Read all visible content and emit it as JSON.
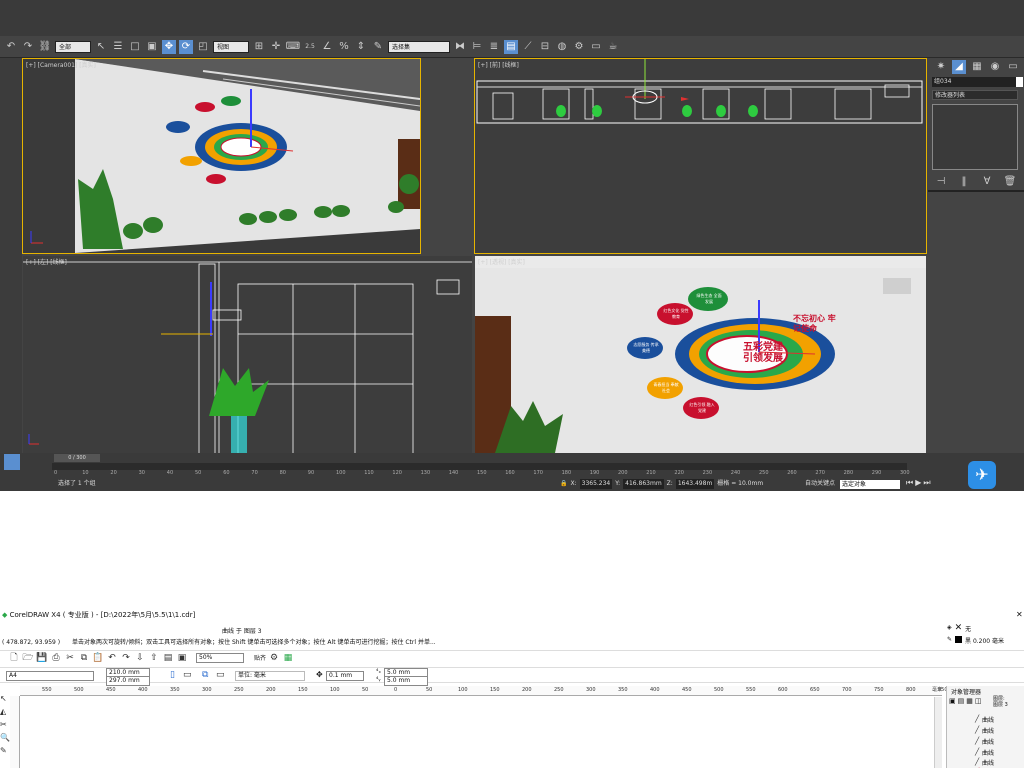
{
  "max": {
    "toolbar": {
      "filter_select": "全部",
      "view_select": "视图",
      "snap_text": "2.5",
      "sel_set_select": "选择集",
      "buttons": [
        "undo-icon",
        "redo-icon",
        "link-icon",
        "select-icon",
        "region-icon",
        "move-icon",
        "rotate-icon",
        "scale-icon",
        "snap-icon",
        "angle-snap-icon",
        "percent-snap-icon",
        "spinner-snap-icon",
        "mirror-icon",
        "align-icon",
        "layer-icon",
        "graph-icon",
        "material-icon",
        "render-setup-icon",
        "render-icon",
        "render-frame-icon"
      ]
    },
    "viewports": {
      "camera": "[+] [Camera001] [真实]",
      "front": "[+] [前] [线框]",
      "left": "[+] [左] [线框]",
      "perspective": "[+] [透视] [真实]"
    },
    "sign": {
      "center_line1": "五彩党建",
      "center_line2": "引领发展",
      "arc_text": "不忘初心 牢记使命",
      "bubble1": "绿色生态 全面发展",
      "bubble2": "红色文化 党性教育",
      "bubble3": "志愿服务 传承美德",
      "bubble4": "青春担当 奉献社会",
      "bubble5": "红色引领 融入党建",
      "bubble1_color": "#1e8f3a",
      "bubble2_color": "#c8102e",
      "bubble3_color": "#1a4f9c",
      "bubble4_color": "#f2a100",
      "bubble5_color": "#c8102e"
    },
    "command_panel": {
      "object_name": "组034",
      "modifier_list": "修改器列表"
    },
    "timeline": {
      "frame_counter": "0 / 300",
      "ruler": [
        "0",
        "10",
        "20",
        "30",
        "40",
        "50",
        "60",
        "70",
        "80",
        "90",
        "100",
        "110",
        "120",
        "130",
        "140",
        "150",
        "160",
        "170",
        "180",
        "190",
        "200",
        "210",
        "220",
        "230",
        "240",
        "250",
        "260",
        "270",
        "280",
        "290",
        "300"
      ]
    },
    "status": {
      "selection_text": "选择了 1 个组",
      "x_label": "X:",
      "x": "3365.234",
      "y_label": "Y:",
      "y": "416.863mm",
      "z_label": "Z:",
      "z": "1643.498m",
      "grid": "栅格 = 10.0mm",
      "auto_key": "自动关键点",
      "key_select": "选定对象"
    }
  },
  "corel": {
    "title": "CorelDRAW X4 ( 专业版 ) - [D:\\2022年\\5月\\5.5\\1\\1.cdr]",
    "status_center": "曲线 于 图层 3",
    "hint_coords": "( 478.872, 93.959 )",
    "hint_text": "单击对象两次可旋转/倾斜；双击工具可选择所有对象；按住 Shift 键单击可选择多个对象；按住 Alt 键单击可进行挖掘；按住 Ctrl 并单...",
    "fill": "无",
    "outline": "黑  0.200 毫米",
    "zoom": "50%",
    "snap_label": "贴齐",
    "paper": "A4",
    "width": "210.0 mm",
    "height": "297.0 mm",
    "unit_label": "单位: 毫米",
    "nudge": "0.1 mm",
    "dup_x": "5.0 mm",
    "dup_y": "5.0 mm",
    "ruler": [
      "550",
      "500",
      "450",
      "400",
      "350",
      "300",
      "250",
      "200",
      "150",
      "100",
      "50",
      "0",
      "50",
      "100",
      "150",
      "200",
      "250",
      "300",
      "350",
      "400",
      "450",
      "500",
      "550",
      "600",
      "650",
      "700",
      "750",
      "800",
      "850"
    ],
    "ruler_unit": "毫米",
    "object_manager": {
      "title": "对象管理器",
      "layer": "图层:",
      "layer_name": "图层 3",
      "items": [
        "曲线",
        "曲线",
        "曲线",
        "曲线",
        "曲线",
        "曲线"
      ]
    }
  }
}
